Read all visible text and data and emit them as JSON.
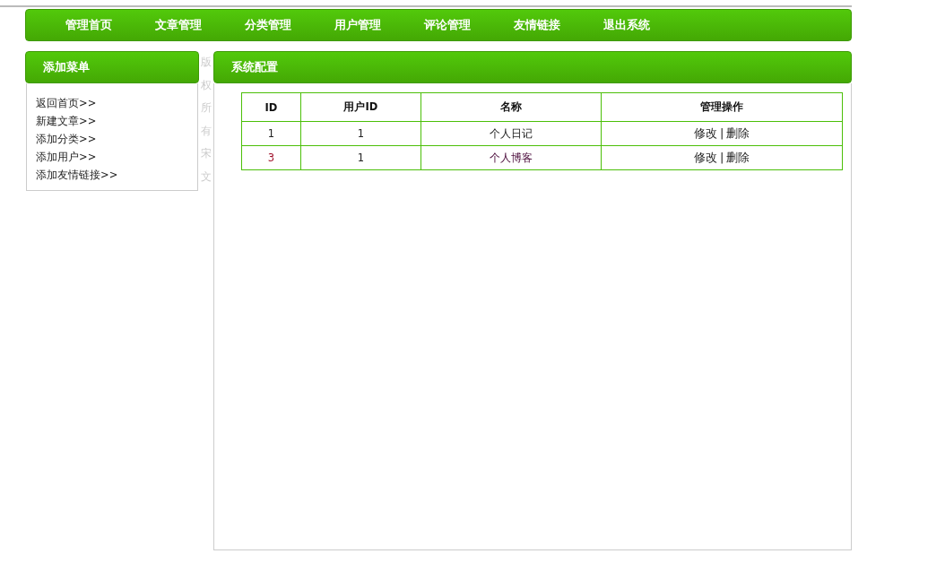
{
  "nav": [
    {
      "label": "管理首页"
    },
    {
      "label": "文章管理"
    },
    {
      "label": "分类管理"
    },
    {
      "label": "用户管理"
    },
    {
      "label": "评论管理"
    },
    {
      "label": "友情链接"
    },
    {
      "label": "退出系统"
    }
  ],
  "sidebar": {
    "title": "添加菜单",
    "items": [
      {
        "label": "返回首页>>"
      },
      {
        "label": "新建文章>>"
      },
      {
        "label": "添加分类>>"
      },
      {
        "label": "添加用户>>"
      },
      {
        "label": "添加友情链接>>"
      }
    ]
  },
  "copyright": "版权所有宋文",
  "main": {
    "title": "系统配置",
    "table": {
      "columns": [
        "ID",
        "用户ID",
        "名称",
        "管理操作"
      ],
      "rows": [
        {
          "id": "1",
          "user_id": "1",
          "name": "个人日记",
          "edit": "修改",
          "separator": "|",
          "delete": "删除",
          "visited": false
        },
        {
          "id": "3",
          "user_id": "1",
          "name": "个人博客",
          "edit": "修改",
          "separator": "|",
          "delete": "删除",
          "visited": true
        }
      ]
    }
  }
}
